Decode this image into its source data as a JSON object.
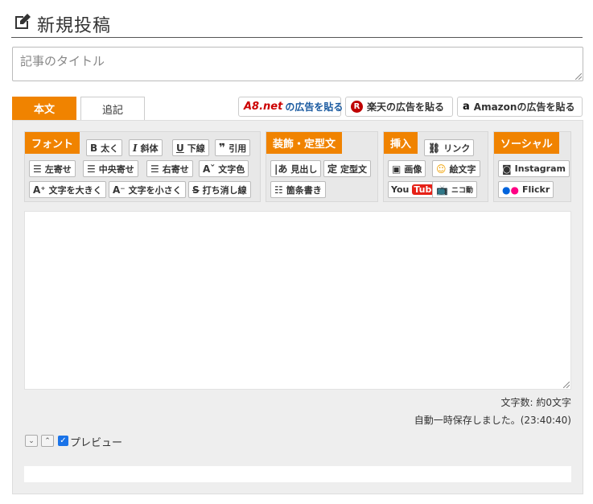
{
  "header": {
    "title": "新規投稿",
    "icon": "edit-icon"
  },
  "title_input": {
    "placeholder": "記事のタイトル",
    "value": ""
  },
  "tabs": [
    {
      "label": "本文",
      "active": true
    },
    {
      "label": "追記",
      "active": false
    }
  ],
  "ads": {
    "a8_logo": "A8.net",
    "a8_label": "の広告を貼る",
    "rakuten_label": "楽天の広告を貼る",
    "amazon_label": "Amazonの広告を貼る"
  },
  "groups": {
    "font": {
      "title": "フォント",
      "buttons": {
        "bold": "太く",
        "italic": "斜体",
        "underline": "下線",
        "quote": "引用",
        "align_left": "左寄せ",
        "align_center": "中央寄せ",
        "align_right": "右寄せ",
        "color": "文字色",
        "bigger": "文字を大きく",
        "smaller": "文字を小さく",
        "strike": "打ち消し線"
      }
    },
    "decoration": {
      "title": "装飾・定型文",
      "buttons": {
        "heading": "見出し",
        "template": "定型文",
        "list": "箇条書き"
      }
    },
    "insert": {
      "title": "挿入",
      "buttons": {
        "link": "リンク",
        "image": "画像",
        "emoji": "絵文字",
        "youtube_you": "You",
        "youtube_tube": "Tube",
        "niconico": "ニコ動"
      }
    },
    "social": {
      "title": "ソーシャル",
      "buttons": {
        "instagram": "Instagram",
        "flickr": "Flickr"
      }
    }
  },
  "status": {
    "char_count": "文字数: 約0文字",
    "autosave": "自動一時保存しました。(23:40:40)"
  },
  "preview": {
    "label": "プレビュー",
    "checked": true
  },
  "colors": {
    "accent": "#f08300",
    "panel": "#eeeeee",
    "youtube_red": "#e62117",
    "rakuten_red": "#bf0000"
  }
}
